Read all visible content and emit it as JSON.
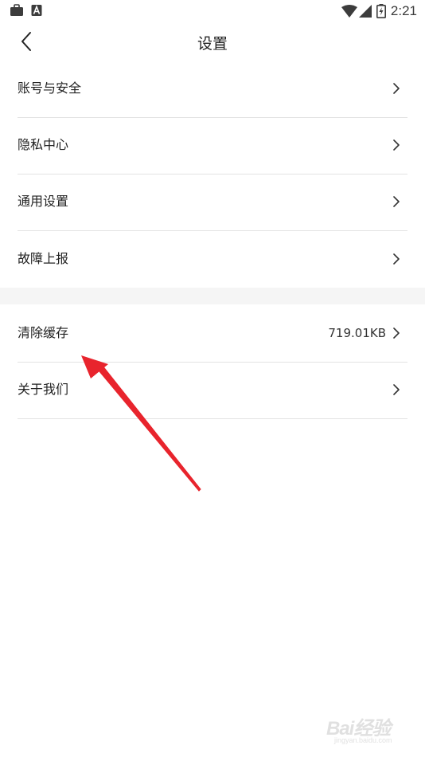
{
  "status_bar": {
    "time": "2:21",
    "left_icons": [
      "briefcase-icon",
      "font-a-icon"
    ],
    "right_icons": [
      "wifi-icon",
      "cellular-signal-icon",
      "battery-charging-icon"
    ]
  },
  "header": {
    "title": "设置",
    "back_icon": "chevron-left-icon"
  },
  "menu": {
    "group1": [
      {
        "label": "账号与安全"
      },
      {
        "label": "隐私中心"
      },
      {
        "label": "通用设置"
      },
      {
        "label": "故障上报"
      }
    ],
    "group2": [
      {
        "label": "清除缓存",
        "value": "719.01KB"
      },
      {
        "label": "关于我们"
      }
    ]
  },
  "annotation": {
    "arrow_color": "#e8242d"
  },
  "watermark": {
    "brand": "Bai经验",
    "url": "jingyan.baidu.com"
  }
}
